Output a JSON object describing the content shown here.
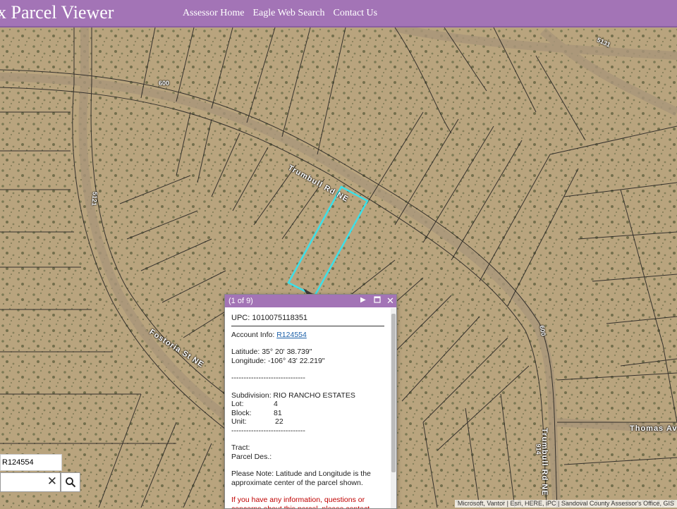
{
  "header": {
    "title": "x Parcel Viewer",
    "nav": [
      "Assessor Home",
      "Eagle Web Search",
      "Contact Us"
    ]
  },
  "map": {
    "road_labels": {
      "trumbull_top": "Trumbull Rd NE",
      "trumbull_right": "Trumbull Rd NE",
      "fostoria": "Fostoria St NE",
      "thomas": "Thomas Av"
    },
    "num_labels": [
      "600",
      "600",
      "914",
      "5121",
      "5131"
    ],
    "attribution": "Microsoft, Vantor | Esri, HERE, iPC | Sandoval County Assessor's Office, GIS"
  },
  "popup": {
    "count": "(1 of 9)",
    "upc": "UPC: 1010075118351",
    "account_label": "Account Info:",
    "account_link": "R124554",
    "latitude": "Latitude: 35° 20' 38.739\"",
    "longitude": "Longitude: -106° 43' 22.219\"",
    "separator": "------------------------------",
    "subdivision": "Subdivision: RIO RANCHO ESTATES",
    "fields": [
      {
        "label": "Lot:",
        "value": "4"
      },
      {
        "label": "Block:",
        "value": "81"
      },
      {
        "label": "Unit:",
        "value": "22"
      }
    ],
    "tract": "Tract:",
    "parcel_des": "Parcel Des.:",
    "note": "Please Note: Latitude and Longitude is the approximate center of the parcel shown.",
    "red_note": "If you have any information, questions or concerns about this parcel, please contact"
  },
  "search": {
    "result": "R124554",
    "value": "",
    "icon": "search-icon"
  }
}
